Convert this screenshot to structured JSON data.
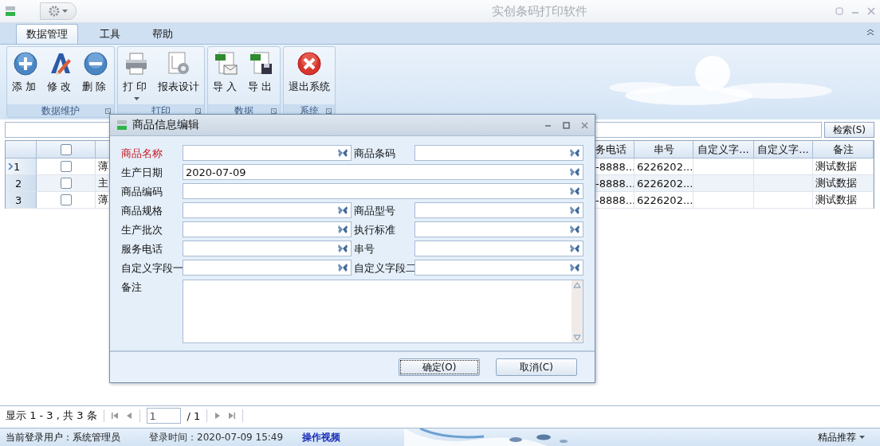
{
  "window": {
    "title": "实创条码打印软件"
  },
  "ribbon": {
    "tabs": [
      {
        "label": "数据管理",
        "selected": true
      },
      {
        "label": "工具",
        "selected": false
      },
      {
        "label": "帮助",
        "selected": false
      }
    ],
    "groups": [
      {
        "label": "数据维护",
        "buttons": [
          {
            "label": "添加",
            "kind": "add",
            "dropdown": false
          },
          {
            "label": "修改",
            "kind": "edit",
            "dropdown": false
          },
          {
            "label": "删除",
            "kind": "delete",
            "dropdown": false
          }
        ]
      },
      {
        "label": "打印",
        "buttons": [
          {
            "label": "打印",
            "kind": "print",
            "dropdown": true
          },
          {
            "label": "报表设计",
            "kind": "report",
            "dropdown": false
          }
        ]
      },
      {
        "label": "数据",
        "buttons": [
          {
            "label": "导入",
            "kind": "import",
            "dropdown": false
          },
          {
            "label": "导出",
            "kind": "export",
            "dropdown": false
          }
        ]
      },
      {
        "label": "系统",
        "buttons": [
          {
            "label": "退出系统",
            "kind": "exit",
            "dropdown": false
          }
        ]
      }
    ]
  },
  "search": {
    "button": "检索(S)"
  },
  "table": {
    "all_checked": false,
    "columns": [
      {
        "kind": "rowhead"
      },
      {
        "kind": "check"
      },
      {
        "kind": "text"
      },
      {
        "kind": "text",
        "label": "务电话"
      },
      {
        "kind": "text",
        "label": "串号"
      },
      {
        "kind": "text",
        "label": "自定义字..."
      },
      {
        "kind": "text",
        "label": "自定义字..."
      },
      {
        "kind": "text",
        "label": "备注"
      }
    ],
    "rows": [
      {
        "number": "1",
        "current": true,
        "checked": false,
        "cells": [
          "薄",
          "-8888...",
          "6226202...",
          null,
          null,
          "测试数据"
        ]
      },
      {
        "number": "2",
        "current": false,
        "checked": false,
        "cells": [
          "主",
          "-8888...",
          "6226202...",
          null,
          null,
          "测试数据"
        ]
      },
      {
        "number": "3",
        "current": false,
        "checked": false,
        "cells": [
          "薄",
          "-8888...",
          "6226202...",
          null,
          null,
          "测试数据"
        ]
      }
    ]
  },
  "pager": {
    "summary": "显示 1 - 3 , 共 3 条",
    "page": "1",
    "total": "/ 1"
  },
  "status_bar": {
    "user": "当前登录用户：系统管理员",
    "login_time": "登录时间：2020-07-09 15:49",
    "video_link": "操作视频",
    "recommend": "精品推荐"
  },
  "dialog": {
    "title": "商品信息编辑",
    "rows": [
      [
        {
          "label": "商品名称",
          "required": true
        },
        {
          "label": "商品条码",
          "required": false
        }
      ],
      [
        {
          "label": "生产日期",
          "required": false,
          "value": "2020-07-09"
        }
      ],
      [
        {
          "label": "商品编码",
          "required": false
        }
      ],
      [
        {
          "label": "商品规格",
          "required": false
        },
        {
          "label": "商品型号",
          "required": false
        }
      ],
      [
        {
          "label": "生产批次",
          "required": false
        },
        {
          "label": "执行标准",
          "required": false
        }
      ],
      [
        {
          "label": "服务电话",
          "required": false
        },
        {
          "label": "串号",
          "required": false
        }
      ],
      [
        {
          "label": "自定义字段一",
          "required": false
        },
        {
          "label": "自定义字段二",
          "required": false
        }
      ]
    ],
    "notes": {
      "label": "备注"
    },
    "buttons": [
      {
        "label": "确定(O)",
        "focused": true
      },
      {
        "label": "取消(C)",
        "focused": false
      }
    ]
  }
}
